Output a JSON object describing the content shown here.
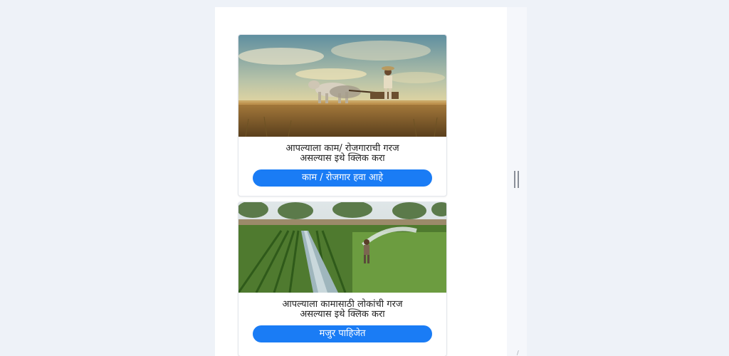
{
  "cards": [
    {
      "image_icon": "farmer-ploughing-with-oxen-image",
      "text": "आपल्याला काम/ रोजगाराची गरज\nअसल्यास इथे क्लिक करा",
      "button_label": "काम / रोजगार हवा आहे"
    },
    {
      "image_icon": "farm-field-irrigation-image",
      "text": "आपल्याला कामासाठी लोकांची गरज\nअसल्यास इथे क्लिक करा",
      "button_label": "मजुर पाहिजेत"
    }
  ],
  "colors": {
    "button": "#1a7cf5",
    "page_background": "#eef2f8",
    "panel_background": "#ffffff"
  }
}
